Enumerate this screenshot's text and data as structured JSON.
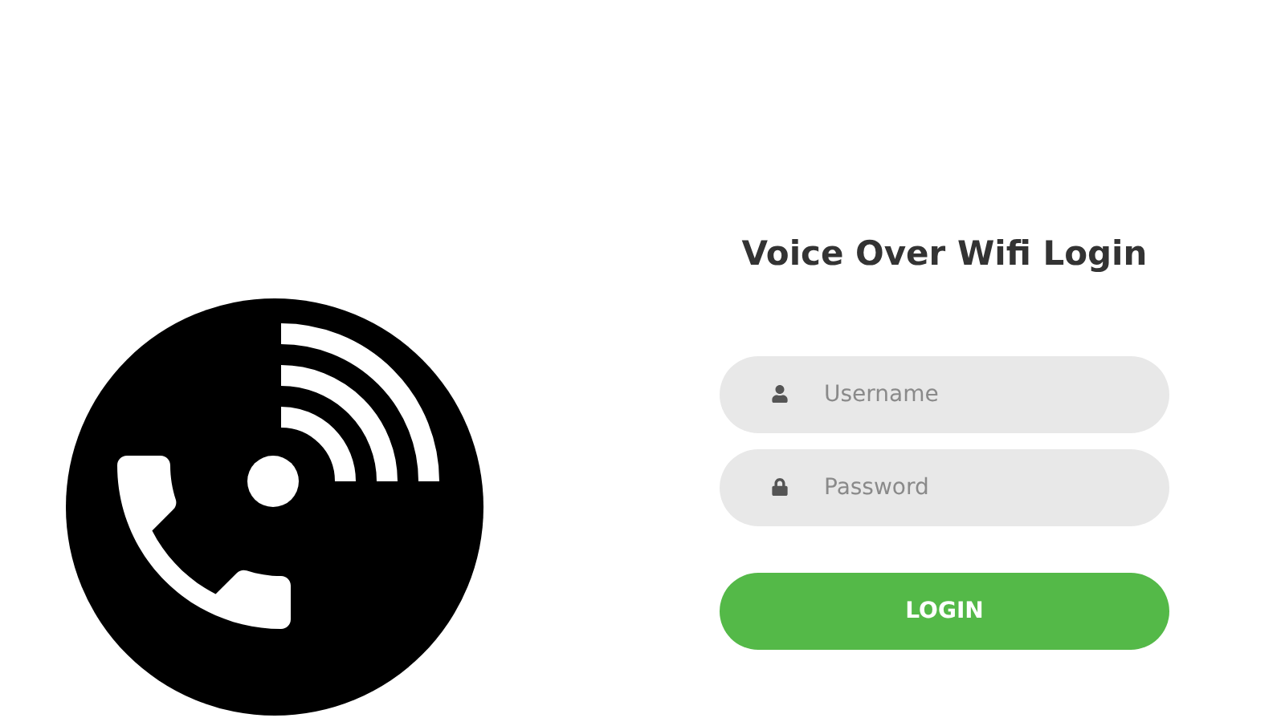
{
  "login": {
    "title": "Voice Over Wifi Login",
    "fields": [
      {
        "kind": "user",
        "placeholder": "Username"
      },
      {
        "kind": "password",
        "placeholder": "Password"
      }
    ],
    "button": "LOGIN"
  }
}
